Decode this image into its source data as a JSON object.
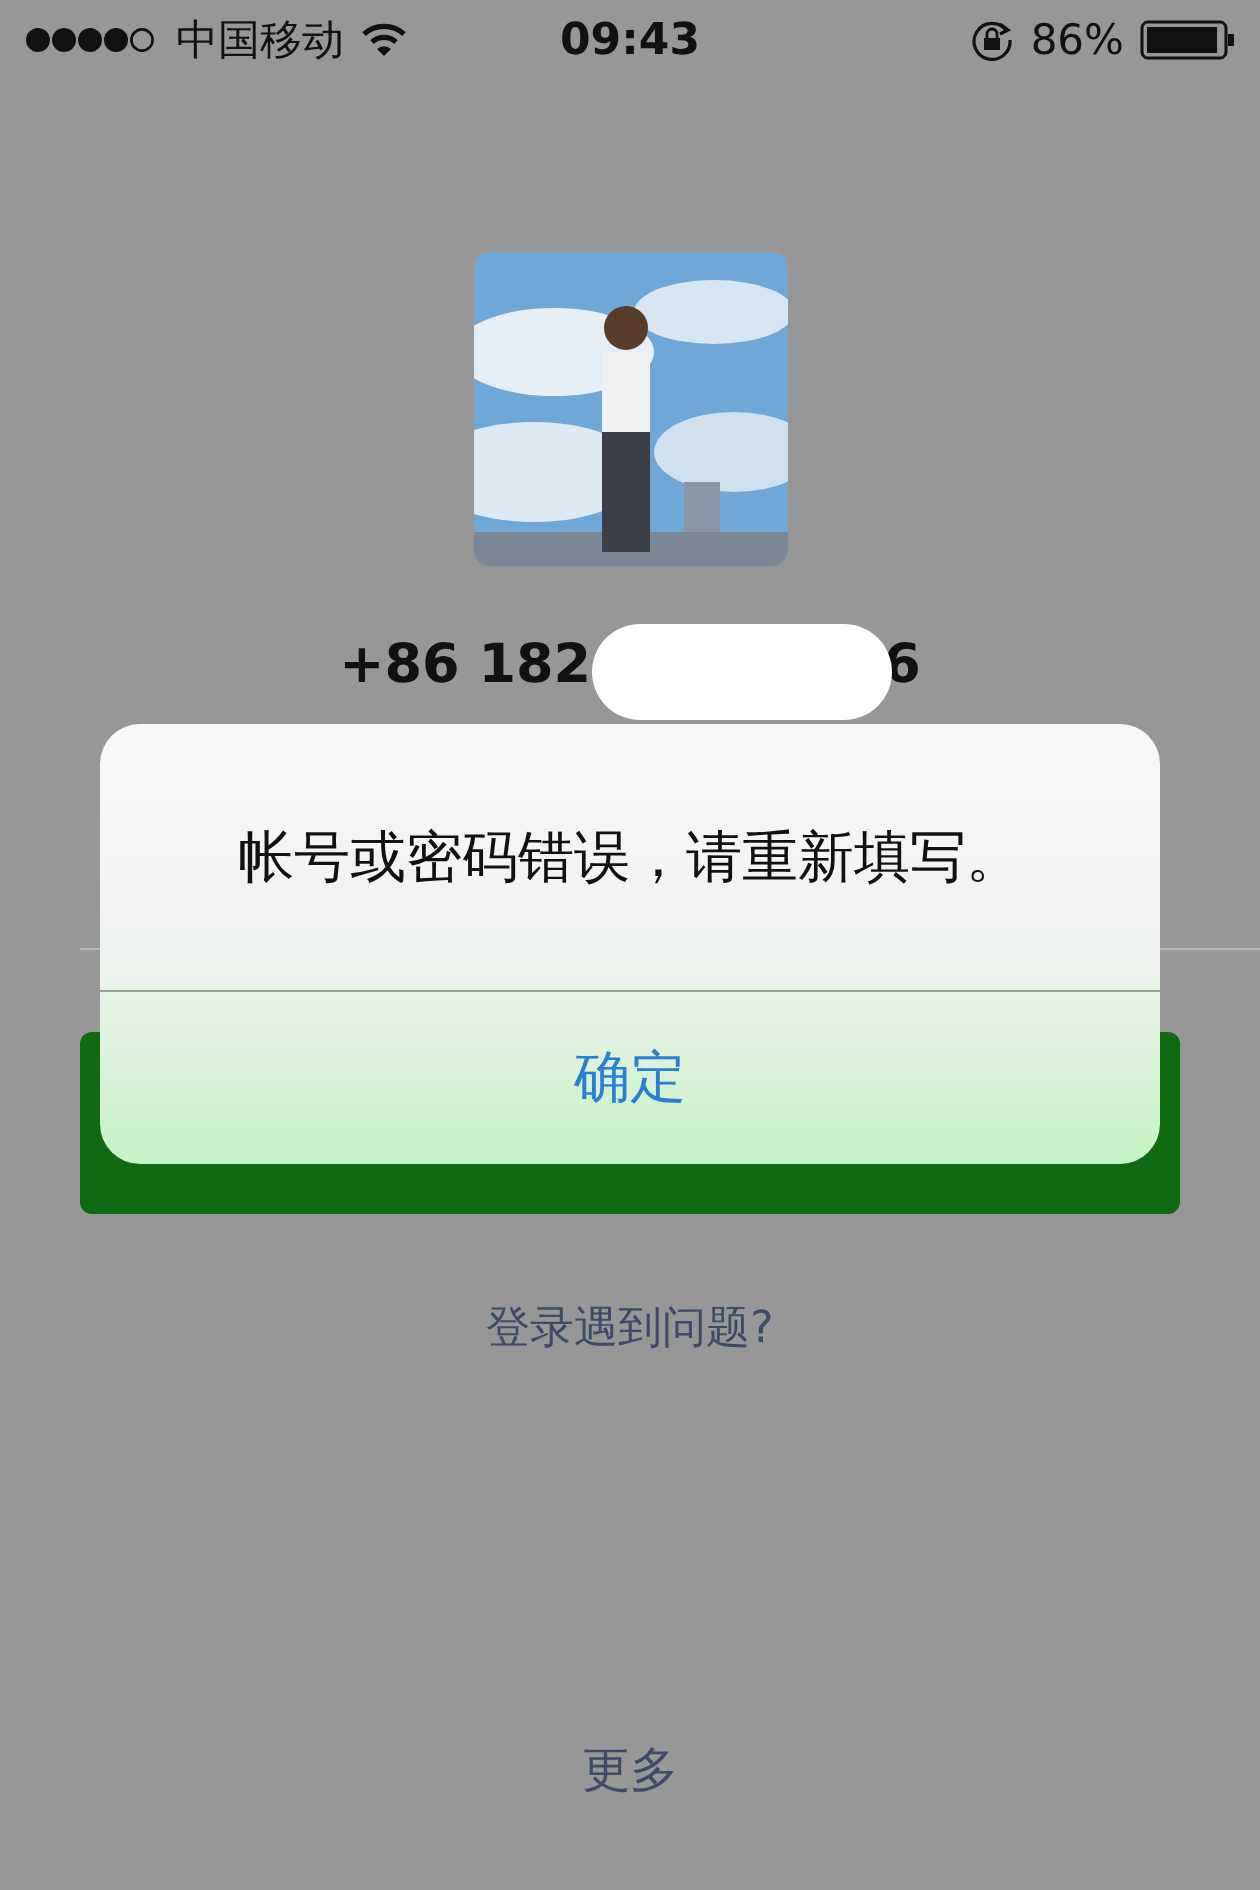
{
  "status_bar": {
    "carrier": "中国移动",
    "time": "09:43",
    "battery": "86%"
  },
  "profile": {
    "phone_prefix": "+86 182",
    "phone_suffix": "6"
  },
  "help_link": "登录遇到问题?",
  "more_link": "更多",
  "alert": {
    "message": "帐号或密码错误，请重新填写。",
    "buttons": [
      {
        "label": "确定"
      }
    ]
  }
}
